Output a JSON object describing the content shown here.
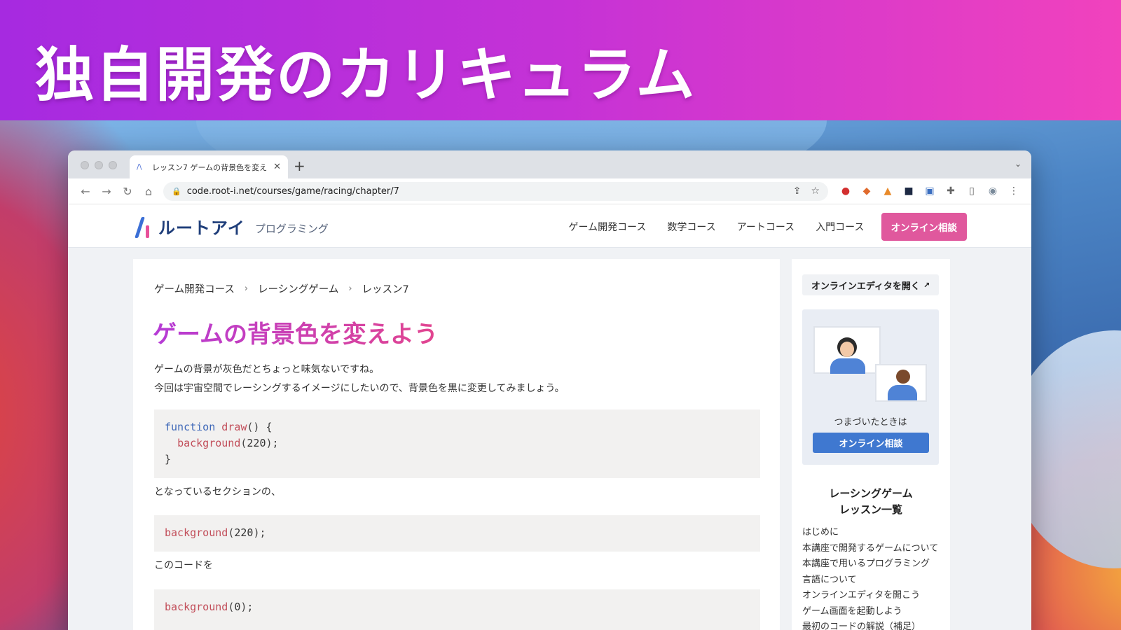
{
  "banner": {
    "title": "独自開発のカリキュラム"
  },
  "browser": {
    "tab_title": "レッスン7 ゲームの背景色を変え",
    "tab_favicon": "/\\",
    "url": "code.root-i.net/courses/game/racing/chapter/7",
    "icons": [
      "back-icon",
      "forward-icon",
      "reload-icon",
      "home-icon",
      "lock-icon",
      "share-icon",
      "star-icon",
      "adblock-icon",
      "extension-icon",
      "extensions-puzzle-icon",
      "sidepanel-icon",
      "profile-icon",
      "menu-icon"
    ]
  },
  "site": {
    "logo_text": "ルートアイ",
    "logo_sub": "プログラミング",
    "nav": [
      "ゲーム開発コース",
      "数学コース",
      "アートコース",
      "入門コース"
    ],
    "cta": "オンライン相談",
    "colors": {
      "brand_blue": "#3b6fd6",
      "brand_pink": "#e0589d",
      "heading_from": "#b53bd6",
      "heading_to": "#e2458f"
    }
  },
  "main": {
    "breadcrumb": [
      "ゲーム開発コース",
      "レーシングゲーム",
      "レッスン7"
    ],
    "heading": "ゲームの背景色を変えよう",
    "intro_1": "ゲームの背景が灰色だとちょっと味気ないですね。",
    "intro_2": "今回は宇宙空間でレーシングするイメージにしたいので、背景色を黒に変更してみましょう。",
    "code1": {
      "l1_kw": "function",
      "l1_fn": "draw",
      "l1_rest": "() {",
      "l2_fn": "background",
      "l2_open": "(",
      "l2_num": "220",
      "l2_close": ");",
      "l3": "}"
    },
    "text_after_code1": "となっているセクションの、",
    "code2": {
      "fn": "background",
      "open": "(",
      "num": "220",
      "close": ");"
    },
    "text_after_code2": "このコードを",
    "code3": {
      "fn": "background",
      "open": "(",
      "num": "0",
      "close": ");"
    }
  },
  "sidebar": {
    "open_editor": "オンラインエディタを開く",
    "consult_label": "つまづいたときは",
    "consult_button": "オンライン相談",
    "lesson_title_1": "レーシングゲーム",
    "lesson_title_2": "レッスン一覧",
    "lessons": [
      "はじめに",
      "本講座で開発するゲームについて",
      "本講座で用いるプログラミング",
      "言語について",
      "オンラインエディタを開こう",
      "ゲーム画面を起動しよう",
      "最初のコードの解説（補足）"
    ]
  }
}
